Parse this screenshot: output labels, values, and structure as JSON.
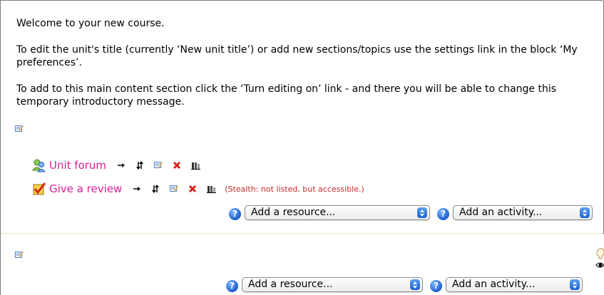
{
  "intro": {
    "welcome": "Welcome to your new course.",
    "edit_title_text": "To edit the unit's title (currently ‘New unit title’) or add new sections/topics use the settings link in the block ‘My preferences’.",
    "add_content_text": "To add to this main content section click the ‘Turn editing on’ link - and there you will be able to change this temporary introductory message."
  },
  "modules": [
    {
      "name": "Unit forum",
      "icon": "forum-icon",
      "stealth": ""
    },
    {
      "name": "Give a review",
      "icon": "feedback-icon",
      "stealth": "(Stealth: not listed, but accessible.)"
    }
  ],
  "controls": {
    "resource_select": "Add a resource...",
    "activity_select": "Add an activity...",
    "help_glyph": "?"
  },
  "colors": {
    "link": "#d2229a",
    "stealth": "#cc2a2a",
    "help": "#1f5fd1",
    "section_border": "#f3e6c9"
  }
}
